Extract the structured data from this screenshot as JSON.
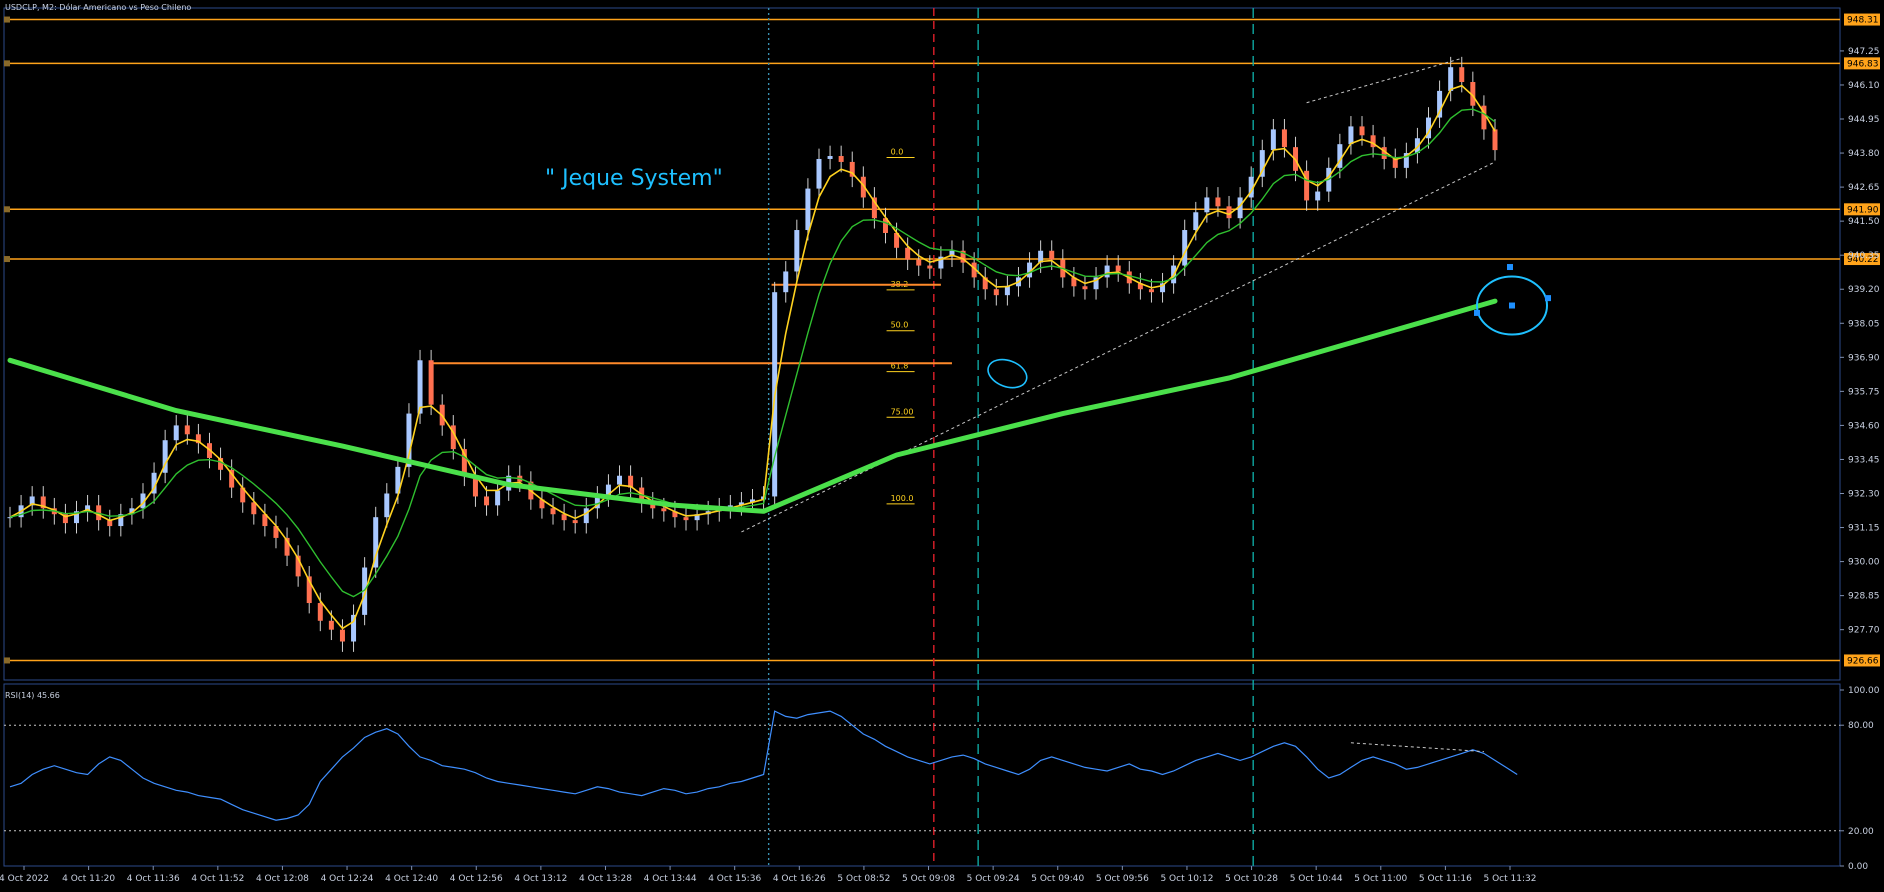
{
  "header": {
    "symbol_label": "USDCLP, M2:  Dólar Americano vs Peso Chileno",
    "annotation": "\" Jeque System\""
  },
  "rsi_panel": {
    "label": "RSI(14) 45.66"
  },
  "colors": {
    "background": "#000000",
    "axis": "#2c4a8a",
    "level_line": "#ffa31a",
    "ma_fast": "#ffd21f",
    "ma_mid": "#2fbf2f",
    "ma_slow": "#4be04b",
    "candle_bull": "#a9c8ff",
    "candle_bear": "#ff7050",
    "rsi_line": "#3f8fff",
    "annotation": "#1ec0ff",
    "red_vline": "#e0202a",
    "teal_vline": "#0ea7a0"
  },
  "chart_data": {
    "type": "line",
    "title": "USDCLP, M2:  Dólar Americano vs Peso Chileno",
    "ylim": [
      926.0,
      948.7
    ],
    "y_ticks": [
      "947.25",
      "946.10",
      "944.95",
      "943.80",
      "942.65",
      "941.50",
      "940.35",
      "939.20",
      "938.05",
      "936.90",
      "935.75",
      "934.60",
      "933.45",
      "932.30",
      "931.15",
      "930.00",
      "928.85",
      "927.70"
    ],
    "x_ticks": [
      "4 Oct 2022",
      "4 Oct 11:20",
      "4 Oct 11:36",
      "4 Oct 11:52",
      "4 Oct 12:08",
      "4 Oct 12:24",
      "4 Oct 12:40",
      "4 Oct 12:56",
      "4 Oct 13:12",
      "4 Oct 13:28",
      "4 Oct 13:44",
      "4 Oct 15:36",
      "4 Oct 16:26",
      "5 Oct 08:52",
      "5 Oct 09:08",
      "5 Oct 09:24",
      "5 Oct 09:40",
      "5 Oct 09:56",
      "5 Oct 10:12",
      "5 Oct 10:28",
      "5 Oct 10:44",
      "5 Oct 11:00",
      "5 Oct 11:16",
      "5 Oct 11:32"
    ],
    "price_levels": [
      {
        "label": "948.31",
        "value": 948.31
      },
      {
        "label": "946.83",
        "value": 946.83
      },
      {
        "label": "941.90",
        "value": 941.9
      },
      {
        "label": "940.22",
        "value": 940.22
      },
      {
        "label": "926.66",
        "value": 926.66
      }
    ],
    "fibonacci_levels": [
      "0.0",
      "38.2",
      "50.0",
      "61.8",
      "75.00",
      "100.0"
    ],
    "fib_range": [
      943.75,
      932.05
    ],
    "close_series": [
      {
        "name": "close",
        "values": [
          931.5,
          931.9,
          932.2,
          931.8,
          931.6,
          931.3,
          931.7,
          931.9,
          931.4,
          931.2,
          931.6,
          931.8,
          932.3,
          933.0,
          934.1,
          934.6,
          934.3,
          934.0,
          933.5,
          933.1,
          932.5,
          932.0,
          931.6,
          931.2,
          930.8,
          930.2,
          929.5,
          928.6,
          928.0,
          927.7,
          927.3,
          928.2,
          929.8,
          931.5,
          932.3,
          933.2,
          935.0,
          936.8,
          935.3,
          934.6,
          933.8,
          932.9,
          932.2,
          931.9,
          932.4,
          932.9,
          932.7,
          932.1,
          931.8,
          931.6,
          931.4,
          931.3,
          931.8,
          932.2,
          932.6,
          932.9,
          932.5,
          932.0,
          931.8,
          931.7,
          931.5,
          931.4,
          931.6,
          931.7,
          931.8,
          931.9,
          932.0,
          932.1,
          932.2,
          939.1,
          939.8,
          941.2,
          942.6,
          943.6,
          943.7,
          943.5,
          943.0,
          942.3,
          941.6,
          941.1,
          940.6,
          940.2,
          940.0,
          939.9,
          940.3,
          940.5,
          940.1,
          939.6,
          939.2,
          939.0,
          939.3,
          939.6,
          940.1,
          940.5,
          940.2,
          939.6,
          939.3,
          939.2,
          939.6,
          940.0,
          939.8,
          939.4,
          939.2,
          939.1,
          939.4,
          940.0,
          941.2,
          941.8,
          942.3,
          942.0,
          941.6,
          942.3,
          943.0,
          943.9,
          944.6,
          944.0,
          943.2,
          942.2,
          942.5,
          943.3,
          944.1,
          944.7,
          944.4,
          944.0,
          943.6,
          943.3,
          943.8,
          944.3,
          945.0,
          945.9,
          946.7,
          946.2,
          945.4,
          944.6,
          943.9
        ]
      }
    ],
    "rsi": {
      "name": "RSI(14)",
      "ylim": [
        0,
        100
      ],
      "levels": [
        "100.00",
        "80.00",
        "20.00",
        "0.00"
      ],
      "values": [
        45,
        47,
        52,
        55,
        57,
        55,
        53,
        52,
        58,
        62,
        60,
        55,
        50,
        47,
        45,
        43,
        42,
        40,
        39,
        38,
        35,
        32,
        30,
        28,
        26,
        27,
        29,
        35,
        48,
        55,
        62,
        67,
        73,
        76,
        78,
        75,
        68,
        62,
        60,
        57,
        56,
        55,
        53,
        50,
        48,
        47,
        46,
        45,
        44,
        43,
        42,
        41,
        43,
        45,
        44,
        42,
        41,
        40,
        42,
        44,
        43,
        41,
        42,
        44,
        45,
        47,
        48,
        50,
        52,
        88,
        85,
        84,
        86,
        87,
        88,
        85,
        80,
        75,
        72,
        68,
        65,
        62,
        60,
        58,
        60,
        62,
        63,
        61,
        58,
        56,
        54,
        52,
        55,
        60,
        62,
        60,
        58,
        56,
        55,
        54,
        56,
        58,
        55,
        54,
        52,
        54,
        57,
        60,
        62,
        64,
        62,
        60,
        62,
        65,
        68,
        70,
        68,
        62,
        55,
        50,
        52,
        56,
        60,
        62,
        60,
        58,
        55,
        56,
        58,
        60,
        62,
        64,
        66,
        64,
        60,
        56,
        52
      ]
    }
  }
}
